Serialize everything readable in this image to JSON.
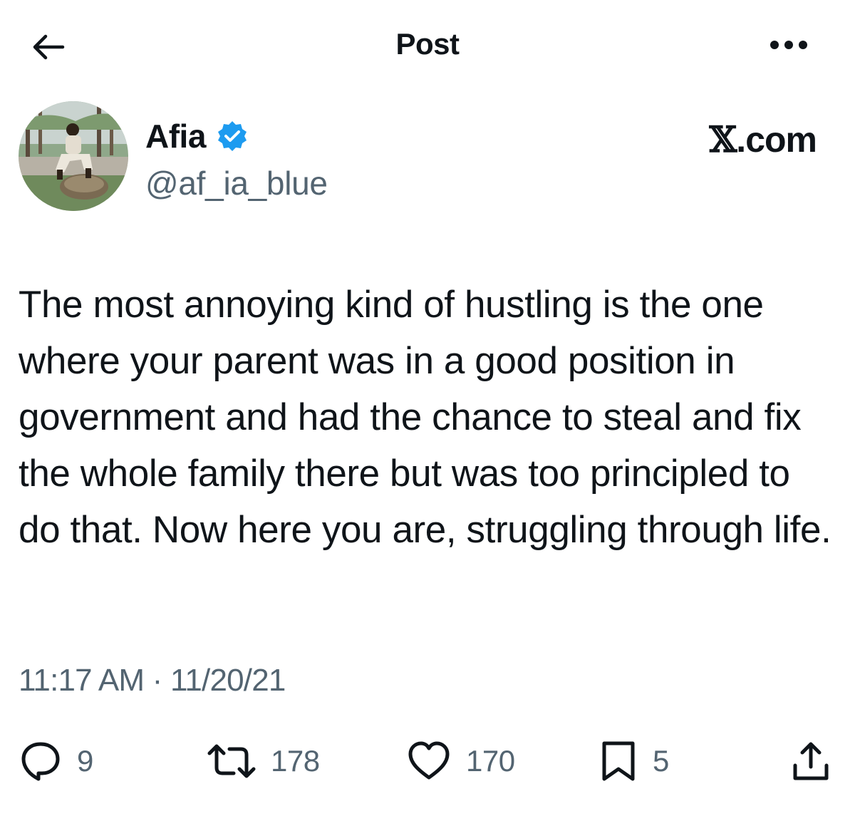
{
  "header": {
    "title": "Post",
    "back_icon": "arrow-left-icon",
    "more_icon": "more-dots-icon"
  },
  "author": {
    "display_name": "Afia",
    "handle": "@af_ia_blue",
    "verified": true,
    "verified_color": "#1d9bf0",
    "avatar_icon": "avatar-photo"
  },
  "site_label": {
    "x_mark": "𝕏",
    "suffix": ".com"
  },
  "tweet": {
    "text": "The most annoying kind of hustling is the one where your parent was in a good position in government and had the chance to steal and fix the whole family there but was too principled to do that. Now here you are, struggling through life.",
    "timestamp": "11:17 AM · 11/20/21"
  },
  "actions": {
    "reply_count": "9",
    "repost_count": "178",
    "like_count": "170",
    "bookmark_count": "5"
  },
  "colors": {
    "text": "#0f1419",
    "secondary": "#536471",
    "accent": "#1d9bf0"
  }
}
